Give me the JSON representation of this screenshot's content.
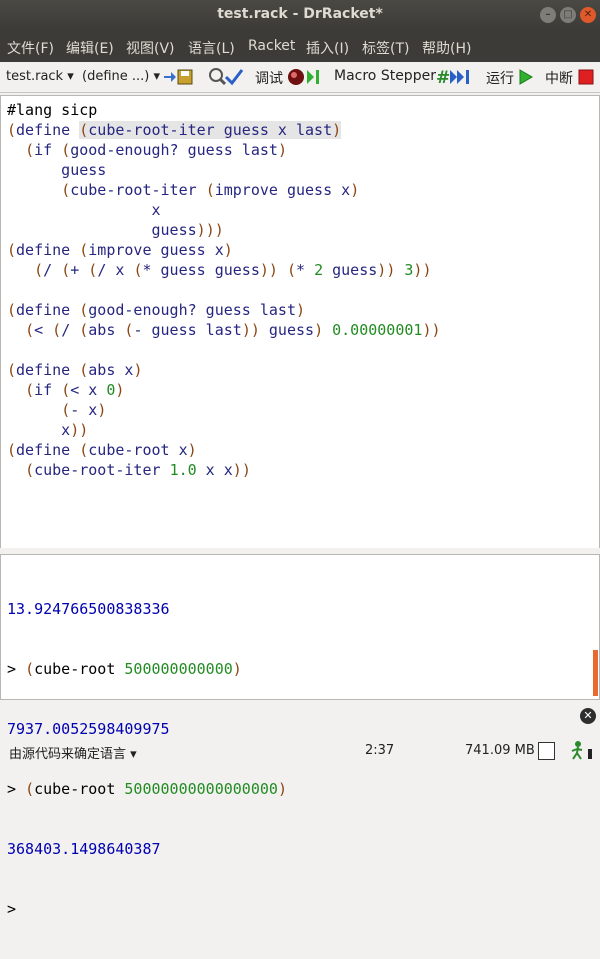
{
  "window": {
    "title": "test.rack - DrRacket*"
  },
  "menu": [
    "文件(F)",
    "编辑(E)",
    "视图(V)",
    "语言(L)",
    "Racket",
    "插入(I)",
    "标签(T)",
    "帮助(H)"
  ],
  "toolbar": {
    "file_dropdown": "test.rack",
    "define_dropdown": "(define ...)",
    "debug_label": "调试",
    "macro_stepper_label": "Macro Stepper",
    "run_label": "运行",
    "stop_label": "中断"
  },
  "editor": {
    "lang_line": "#lang sicp",
    "lines": [
      "(define (cube-root-iter guess x last)",
      "  (if (good-enough? guess last)",
      "      guess",
      "      (cube-root-iter (improve guess x)",
      "                x",
      "                guess)))",
      "(define (improve guess x)",
      "   (/ (+ (/ x (* guess guess)) (* 2 guess)) 3))",
      "",
      "(define (good-enough? guess last)",
      "  (< (/ (abs (- guess last)) guess) 0.00000001))",
      "",
      "(define (abs x)",
      "  (if (< x 0)",
      "      (- x)",
      "      x))",
      "(define (cube-root x)",
      "  (cube-root-iter 1.0 x x))"
    ]
  },
  "repl": {
    "lines": [
      {
        "kind": "out",
        "text": "13.924766500838336"
      },
      {
        "kind": "in",
        "prompt": ">",
        "text": "(cube-root 500000000000)"
      },
      {
        "kind": "out",
        "text": "7937.0052598409975"
      },
      {
        "kind": "in",
        "prompt": ">",
        "text": "(cube-root 50000000000000000)"
      },
      {
        "kind": "out",
        "text": "368403.1498640387"
      },
      {
        "kind": "in",
        "prompt": ">",
        "text": ""
      }
    ]
  },
  "status": {
    "language": "由源代码来确定语言",
    "position": "2:37",
    "memory": "741.09 MB"
  },
  "colors": {
    "keyword": "#262680",
    "paren": "#8b4513",
    "number": "#228b22",
    "output": "#0000b0",
    "stop": "#e02020"
  }
}
